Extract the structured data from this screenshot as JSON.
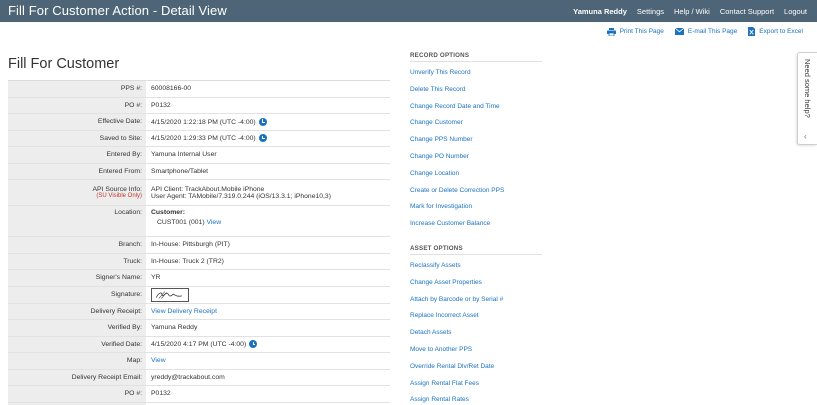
{
  "header": {
    "title": "Fill For Customer Action - Detail View",
    "user": "Yamuna Reddy",
    "nav": [
      "Settings",
      "Help / Wiki",
      "Contact Support",
      "Logout"
    ]
  },
  "subactions": {
    "print": "Print This Page",
    "email": "E-mail This Page",
    "excel": "Export to Excel"
  },
  "page_title": "Fill For Customer",
  "details": {
    "pps_label": "PPS #:",
    "pps_value": "60008166-00",
    "po_label": "PO #:",
    "po_value": "P0132",
    "effective_label": "Effective Date:",
    "effective_value": "4/15/2020 1:22:18 PM (UTC -4:00)",
    "saved_label": "Saved to Site:",
    "saved_value": "4/15/2020 1:29:33 PM (UTC -4:00)",
    "entered_by_label": "Entered By:",
    "entered_by_value": "Yamuna Internal User",
    "entered_from_label": "Entered From:",
    "entered_from_value": "Smartphone/Tablet",
    "api_label": "API Source Info:",
    "api_note": "(SU Visible Only)",
    "api_client": "API Client: TrackAbout.Mobile iPhone",
    "api_agent": "User Agent: TAMobile/7.319.0.244 (iOS/13.3.1; iPhone10,3)",
    "location_label": "Location:",
    "location_heading": "Customer:",
    "location_value": "CUST001 (001)",
    "location_link": "View",
    "branch_label": "Branch:",
    "branch_value": "In-House: Pittsburgh (PIT)",
    "truck_label": "Truck:",
    "truck_value": "In-House: Truck 2 (TR2)",
    "signer_label": "Signer's Name:",
    "signer_value": "YR",
    "signature_label": "Signature:",
    "receipt_label": "Delivery Receipt:",
    "receipt_link": "View Delivery Receipt",
    "verified_by_label": "Verified By:",
    "verified_by_value": "Yamuna Reddy",
    "verified_date_label": "Verified Date:",
    "verified_date_value": "4/15/2020 4:17 PM (UTC -4:00)",
    "map_label": "Map:",
    "map_link": "View",
    "receipt_email_label": "Delivery Receipt Email:",
    "receipt_email_value": "yreddy@trackabout.com",
    "po2_label": "PO #:",
    "po2_value": "P0132"
  },
  "record_options": {
    "heading": "RECORD OPTIONS",
    "items": [
      "Unverify This Record",
      "Delete This Record",
      "Change Record Date and Time",
      "Change Customer",
      "Change PPS Number",
      "Change PO Number",
      "Change Location",
      "Create or Delete Correction PPS",
      "Mark for Investigation",
      "Increase Customer Balance"
    ]
  },
  "asset_options": {
    "heading": "ASSET OPTIONS",
    "items": [
      "Reclassify Assets",
      "Change Asset Properties",
      "Attach by Barcode or by Serial #",
      "Replace Incorrect Asset",
      "Detach Assets",
      "Move to Another PPS",
      "Override Rental Dlv/Ret Date",
      "Assign Rental Flat Fees",
      "Assign Rental Rates"
    ]
  },
  "help_tab": {
    "label": "Need some help?"
  },
  "colors": {
    "header_bg": "#4d6577",
    "link": "#1b72bf",
    "label_bg": "#ededed",
    "warning": "#c0392b"
  }
}
